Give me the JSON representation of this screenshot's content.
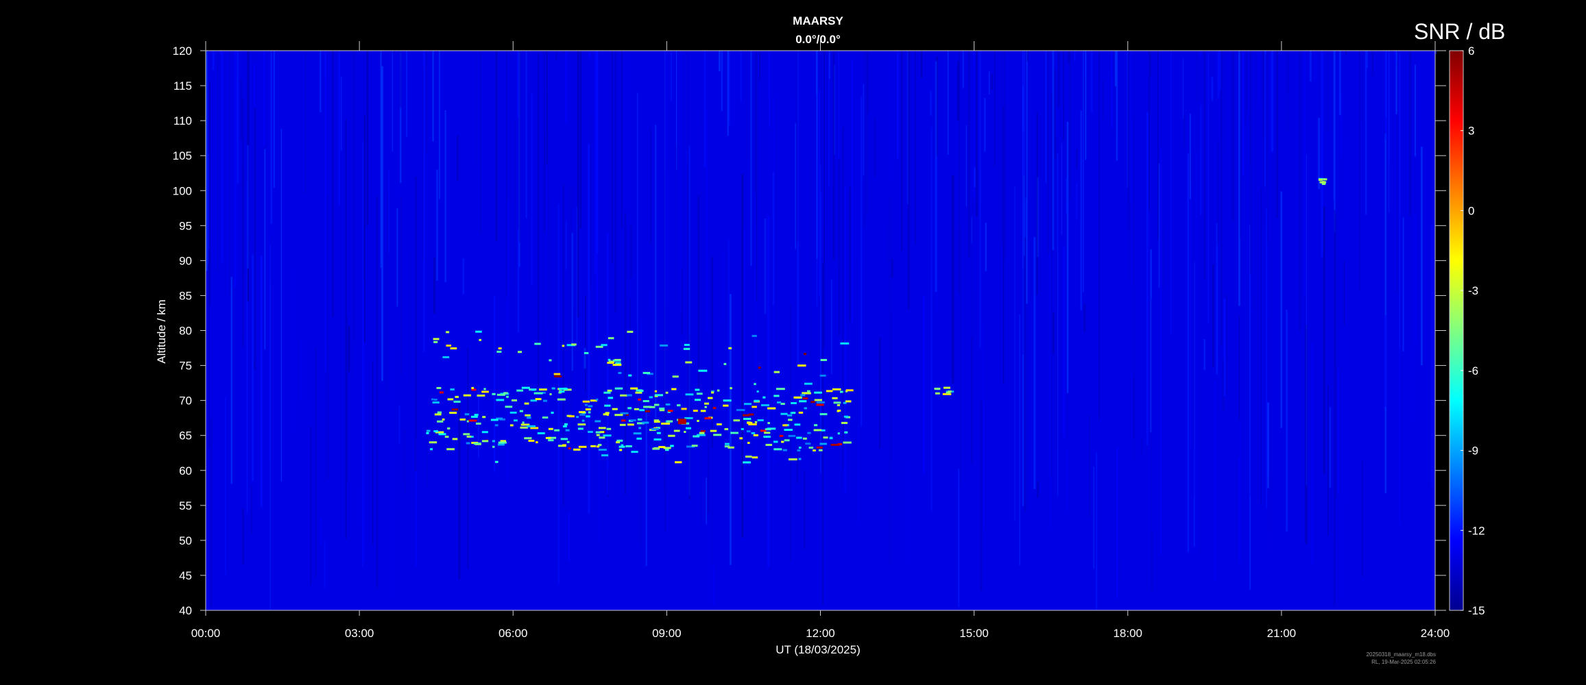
{
  "chart_data": {
    "type": "heatmap",
    "title": "MAARSY",
    "subtitle": "0.0°/0.0°",
    "xlabel": "UT (18/03/2025)",
    "ylabel": "Altitude / km",
    "x_tick_labels": [
      "00:00",
      "03:00",
      "06:00",
      "09:00",
      "12:00",
      "15:00",
      "18:00",
      "21:00",
      "24:00"
    ],
    "xlim_hours": [
      0,
      24
    ],
    "ylim_km": [
      40,
      120
    ],
    "y_ticks": [
      40,
      45,
      50,
      55,
      60,
      65,
      70,
      75,
      80,
      85,
      90,
      95,
      100,
      105,
      110,
      115,
      120
    ],
    "colorbar": {
      "label": "SNR / dB",
      "range": [
        -15,
        6
      ],
      "ticks": [
        6,
        3,
        0,
        -3,
        -6,
        -9,
        -12,
        -15
      ],
      "colormap": [
        "#00008f",
        "#0000ff",
        "#0080ff",
        "#00ffff",
        "#80ff80",
        "#ffff00",
        "#ff8000",
        "#ff0000",
        "#800000"
      ]
    },
    "background_snr_db": -13,
    "echo_features": [
      {
        "t_start_h": 4.3,
        "t_end_h": 12.5,
        "alt_min_km": 61,
        "alt_max_km": 80,
        "peak_snr_db": 6,
        "peak_time_h": 9.3,
        "peak_alt_km": 67
      },
      {
        "t_start_h": 7.8,
        "t_end_h": 8.0,
        "alt_min_km": 75,
        "alt_max_km": 76,
        "peak_snr_db": 3
      },
      {
        "t_start_h": 6.8,
        "t_end_h": 7.0,
        "alt_min_km": 71,
        "alt_max_km": 72,
        "peak_snr_db": 3
      },
      {
        "t_start_h": 14.2,
        "t_end_h": 14.5,
        "alt_min_km": 71,
        "alt_max_km": 72,
        "peak_snr_db": -7
      },
      {
        "t_start_h": 21.7,
        "t_end_h": 21.8,
        "alt_min_km": 101,
        "alt_max_km": 102,
        "peak_snr_db": 3
      }
    ]
  },
  "footer": {
    "filename": "20250318_maarsy_m18.dbs",
    "created": "RL, 19-Mar-2025 02:05:26"
  }
}
